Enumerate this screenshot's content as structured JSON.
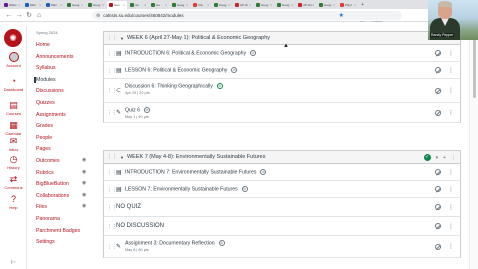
{
  "browser": {
    "tabs": [
      {
        "label": "Webc",
        "color": "#6a1b9a"
      },
      {
        "label": "Mail",
        "color": "#1565c0"
      },
      {
        "label": "Mail",
        "color": "#1565c0"
      },
      {
        "label": "Geog",
        "color": "#2e7d32"
      },
      {
        "label": "Geog",
        "color": "#2e7d32"
      },
      {
        "label": "Geo",
        "color": "#b5121b",
        "active": true
      },
      {
        "label": "Ge",
        "color": "#2e7d32"
      },
      {
        "label": "Ge",
        "color": "#2e7d32"
      },
      {
        "label": "Geog",
        "color": "#2e7d32"
      },
      {
        "label": "Cla",
        "color": "#e53935"
      },
      {
        "label": "Geog",
        "color": "#2e7d32"
      },
      {
        "label": "AP Hi",
        "color": "#c62828"
      },
      {
        "label": "Geog",
        "color": "#2e7d32"
      },
      {
        "label": "Geog",
        "color": "#2e7d32"
      },
      {
        "label": "AP Hu",
        "color": "#c62828"
      },
      {
        "label": "Geog",
        "color": "#2e7d32"
      },
      {
        "label": "Playl",
        "color": "#e53935"
      }
    ],
    "url": "calstatela.instructure.edu/courses/460842/modules",
    "url_display": "calnsts.su.edu/courses/460842/modules",
    "update_label": "STTS"
  },
  "webcam": {
    "name": "Randy Pepper"
  },
  "global_nav": {
    "account": "Account",
    "dashboard": "Dashboard",
    "courses": "Courses",
    "calendar": "Calendar",
    "inbox": "Inbox",
    "history": "History",
    "commons": "Commons",
    "help": "Help",
    "inbox_count": "46"
  },
  "course_nav": {
    "term": "Spring 2024",
    "items": [
      {
        "label": "Home"
      },
      {
        "label": "Announcements"
      },
      {
        "label": "Syllabus"
      },
      {
        "label": "Modules",
        "active": true
      },
      {
        "label": "Discussions"
      },
      {
        "label": "Quizzes"
      },
      {
        "label": "Assignments"
      },
      {
        "label": "Grades"
      },
      {
        "label": "People"
      },
      {
        "label": "Pages"
      },
      {
        "label": "Outcomes",
        "hidden_icon": true
      },
      {
        "label": "Rubrics",
        "hidden_icon": true
      },
      {
        "label": "BigBlueButton",
        "hidden_icon": true
      },
      {
        "label": "Collaborations",
        "hidden_icon": true
      },
      {
        "label": "Files",
        "hidden_icon": true
      },
      {
        "label": "Panorama"
      },
      {
        "label": "Parchment Badges"
      },
      {
        "label": "Settings"
      }
    ]
  },
  "modules": [
    {
      "title": "WEEK 6 (April 27-May 1): Political & Economic Geography",
      "items": [
        {
          "title": "INTRODUCTION 6: Political & Economic Geography",
          "type": "page",
          "meta": ""
        },
        {
          "title": "LESSON 6: Political & Economic Geography",
          "type": "page",
          "meta": ""
        },
        {
          "title": "Discussion 6: Thinking Geographically",
          "type": "discussion",
          "meta": "Apr 29  |  20 pts"
        },
        {
          "title": "Quiz 6",
          "type": "quiz",
          "meta": "May 1  |  40 pts"
        }
      ]
    },
    {
      "title": "WEEK 7 (May 4-8): Environmentally Sustainable Futures",
      "items": [
        {
          "title": "INTRODUCTION 7: Environmentally Sustainable Futures",
          "type": "page",
          "meta": ""
        },
        {
          "title": "LESSON 7: Environmentally Sustainable Futures",
          "type": "page",
          "meta": ""
        },
        {
          "title": "NO QUIZ",
          "type": "header",
          "meta": ""
        },
        {
          "title": "NO DISCUSSION",
          "type": "header",
          "meta": ""
        },
        {
          "title": "Assignment 3: Documentary Reflection",
          "type": "assignment",
          "meta": "May 6  |  80 pts"
        }
      ]
    }
  ],
  "colors": {
    "brand": "#b5121b",
    "published": "#0b874b",
    "text": "#2d3b45"
  }
}
